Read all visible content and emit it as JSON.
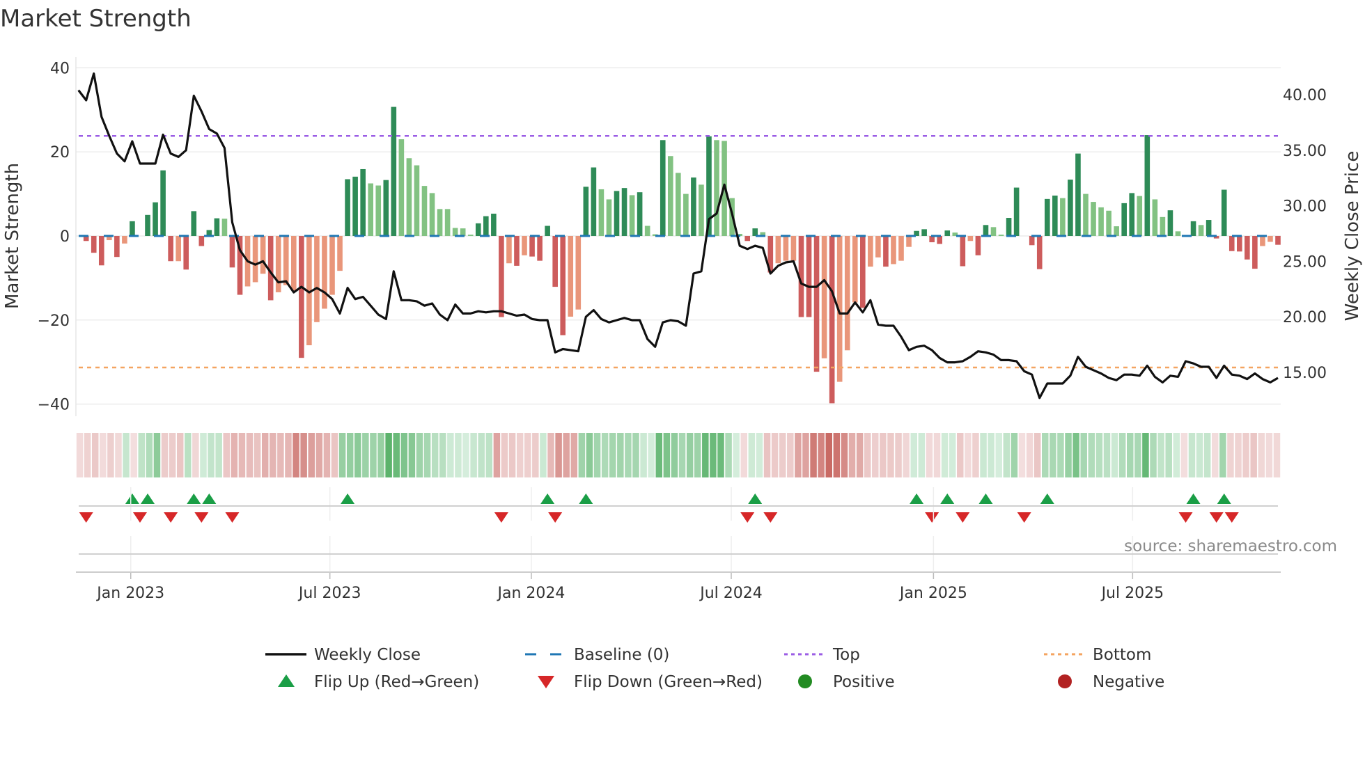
{
  "chart_data": {
    "type": "bar",
    "title": "Market Strength",
    "ylabel": "Market Strength",
    "y2label": "Weekly Close Price",
    "ylim": [
      -42,
      42
    ],
    "y2lim": [
      12.5,
      41.4
    ],
    "yticks": [
      {
        "v": 40,
        "label": "40"
      },
      {
        "v": 20,
        "label": "20"
      },
      {
        "v": 0,
        "label": "0"
      },
      {
        "v": -20,
        "label": "−20"
      },
      {
        "v": -40,
        "label": "−40"
      }
    ],
    "y2ticks": [
      {
        "v": 40,
        "label": "40.00"
      },
      {
        "v": 35,
        "label": "35.00"
      },
      {
        "v": 30,
        "label": "30.00"
      },
      {
        "v": 25,
        "label": "25.00"
      },
      {
        "v": 20,
        "label": "20.00"
      },
      {
        "v": 15,
        "label": "15.00"
      }
    ],
    "xticks": [
      {
        "week": 5.8,
        "label": "Jan 2023"
      },
      {
        "week": 31.7,
        "label": "Jul 2023"
      },
      {
        "week": 57.9,
        "label": "Jan 2024"
      },
      {
        "week": 83.9,
        "label": "Jul 2024"
      },
      {
        "week": 110.2,
        "label": "Jan 2025"
      },
      {
        "week": 136.1,
        "label": "Jul 2025"
      }
    ],
    "top_level": 23.8,
    "bottom_level": -31.3,
    "strength": [
      -1.2,
      -4,
      -7,
      -1,
      -5,
      -1.8,
      3.5,
      0,
      5,
      8,
      15.6,
      -6,
      -6,
      -8,
      5.9,
      -2.4,
      1.4,
      4.2,
      4.1,
      -7.5,
      -14,
      -12,
      -11,
      -9,
      -15.3,
      -13.4,
      -11.7,
      -13,
      -29,
      -26,
      -20.5,
      -17.3,
      -14,
      -8.3,
      13.5,
      14.1,
      15.9,
      12.5,
      12,
      13.3,
      30.7,
      23,
      18.5,
      16.8,
      11.9,
      10.2,
      6.4,
      6.4,
      1.9,
      1.8,
      0.3,
      3,
      4.7,
      5.3,
      -19.3,
      -6.5,
      -7.1,
      -4.6,
      -4.9,
      -5.9,
      2.4,
      -12.1,
      -23.6,
      -19.2,
      -17.5,
      11.7,
      16.3,
      11.1,
      8.7,
      10.7,
      11.4,
      9.7,
      10.4,
      2.4,
      0.4,
      22.8,
      19,
      15,
      10,
      13.9,
      12.2,
      23.7,
      22.8,
      22.6,
      9,
      0.5,
      -1.2,
      1.8,
      0.9,
      -8.7,
      -6.5,
      -5.9,
      -5.9,
      -19.3,
      -19.3,
      -32.3,
      -29.1,
      -39.8,
      -34.7,
      -27.2,
      -15.8,
      -17.1,
      -7.3,
      -5.1,
      -7.3,
      -6.7,
      -5.9,
      -2.6,
      1.2,
      1.6,
      -1.5,
      -1.9,
      1.3,
      0.8,
      -7.2,
      -1.2,
      -4.6,
      2.6,
      2.1,
      0.3,
      4.3,
      11.5,
      0,
      -2.2,
      -7.9,
      8.8,
      9.6,
      9,
      13.4,
      19.6,
      10,
      8.1,
      6.8,
      6,
      2.3,
      7.8,
      10.2,
      9.5,
      24,
      8.7,
      4.5,
      6.1,
      1.1,
      0,
      3.5,
      2.6,
      3.8,
      -0.6,
      11,
      -3.6,
      -3.7,
      -5.6,
      -7.8,
      -2.4,
      -1.4,
      -2.1
    ],
    "shade": "dddldldddddd",
    "shade_rest": "ldddddlddlllldllldllllldddllddlllllllllldd",
    "shades": "dddldldddddd|ldddddlddlll|dllldllllldd|dllddlllllll|llldd|ddldldddddll|ddllddldlldl|lldldllllddl|dllldddldlll|dlld|llldddddldld|dlldddddddld|dlllllddldll|dlddlddddddd|lld",
    "weekly_close": [
      40.4,
      39.5,
      41.9,
      38.0,
      36.3,
      34.7,
      34.0,
      35.8,
      33.8,
      33.8,
      33.8,
      36.4,
      34.7,
      34.4,
      35.0,
      39.9,
      38.5,
      36.9,
      36.5,
      35.2,
      28.5,
      26.0,
      25.0,
      24.7,
      25.0,
      24.0,
      23.1,
      23.2,
      22.2,
      22.7,
      22.2,
      22.6,
      22.2,
      21.6,
      20.3,
      22.6,
      21.6,
      21.8,
      21.0,
      20.2,
      19.8,
      24.1,
      21.5,
      21.5,
      21.4,
      21.0,
      21.2,
      20.2,
      19.7,
      21.1,
      20.3,
      20.3,
      20.5,
      20.4,
      20.5,
      20.5,
      20.3,
      20.1,
      20.2,
      19.8,
      19.7,
      19.7,
      16.8,
      17.1,
      17.0,
      16.9,
      20.0,
      20.6,
      19.8,
      19.5,
      19.7,
      19.9,
      19.7,
      19.7,
      18.0,
      17.3,
      19.5,
      19.7,
      19.6,
      19.2,
      23.9,
      24.1,
      28.8,
      29.3,
      31.9,
      29.3,
      26.4,
      26.1,
      26.4,
      26.2,
      23.9,
      24.6,
      24.9,
      25.0,
      23.0,
      22.7,
      22.7,
      23.3,
      22.3,
      20.3,
      20.3,
      21.3,
      20.4,
      21.5,
      19.3,
      19.2,
      19.2,
      18.2,
      17.0,
      17.3,
      17.4,
      17.0,
      16.3,
      15.9,
      15.9,
      16.0,
      16.4,
      16.9,
      16.8,
      16.6,
      16.1,
      16.1,
      16.0,
      15.1,
      14.8,
      12.7,
      14.0,
      14.0,
      14.0,
      14.7,
      16.4,
      15.5,
      15.2,
      14.9,
      14.5,
      14.3,
      14.8,
      14.8,
      14.7,
      15.6,
      14.6,
      14.1,
      14.7,
      14.6,
      16.0,
      15.8,
      15.5,
      15.5,
      14.5,
      15.6,
      14.8,
      14.7,
      14.4,
      14.9,
      14.4,
      14.1,
      14.5
    ],
    "flip_up_weeks": [
      6,
      8,
      14,
      16,
      34,
      60,
      65,
      87,
      108,
      112,
      117,
      125,
      144,
      148
    ],
    "flip_down_weeks": [
      0,
      7,
      11,
      15,
      19,
      54,
      61,
      86,
      89,
      110,
      114,
      122,
      143,
      147,
      149
    ],
    "legend": {
      "placement": "bottom",
      "entries": [
        {
          "label": "Weekly Close",
          "kind": "line",
          "color": "#111111"
        },
        {
          "label": "Baseline (0)",
          "kind": "dash",
          "color": "#1f77b4"
        },
        {
          "label": "Top",
          "kind": "dot",
          "color": "#9b5de5"
        },
        {
          "label": "Bottom",
          "kind": "dot",
          "color": "#f4a460"
        },
        {
          "label": "Flip Up (Red→Green)",
          "kind": "tri-up",
          "color": "#1a9e46"
        },
        {
          "label": "Flip Down (Green→Red)",
          "kind": "tri-down",
          "color": "#d62728"
        },
        {
          "label": "Positive",
          "kind": "circle",
          "color": "#228b22"
        },
        {
          "label": "Negative",
          "kind": "circle",
          "color": "#b22222"
        }
      ]
    },
    "colors": {
      "pos_dark": "#2e8b57",
      "pos_light": "#82c282",
      "neg_dark": "#cd5c5c",
      "neg_light": "#e9967a"
    },
    "grid": true
  },
  "source": "source: sharemaestro.com"
}
